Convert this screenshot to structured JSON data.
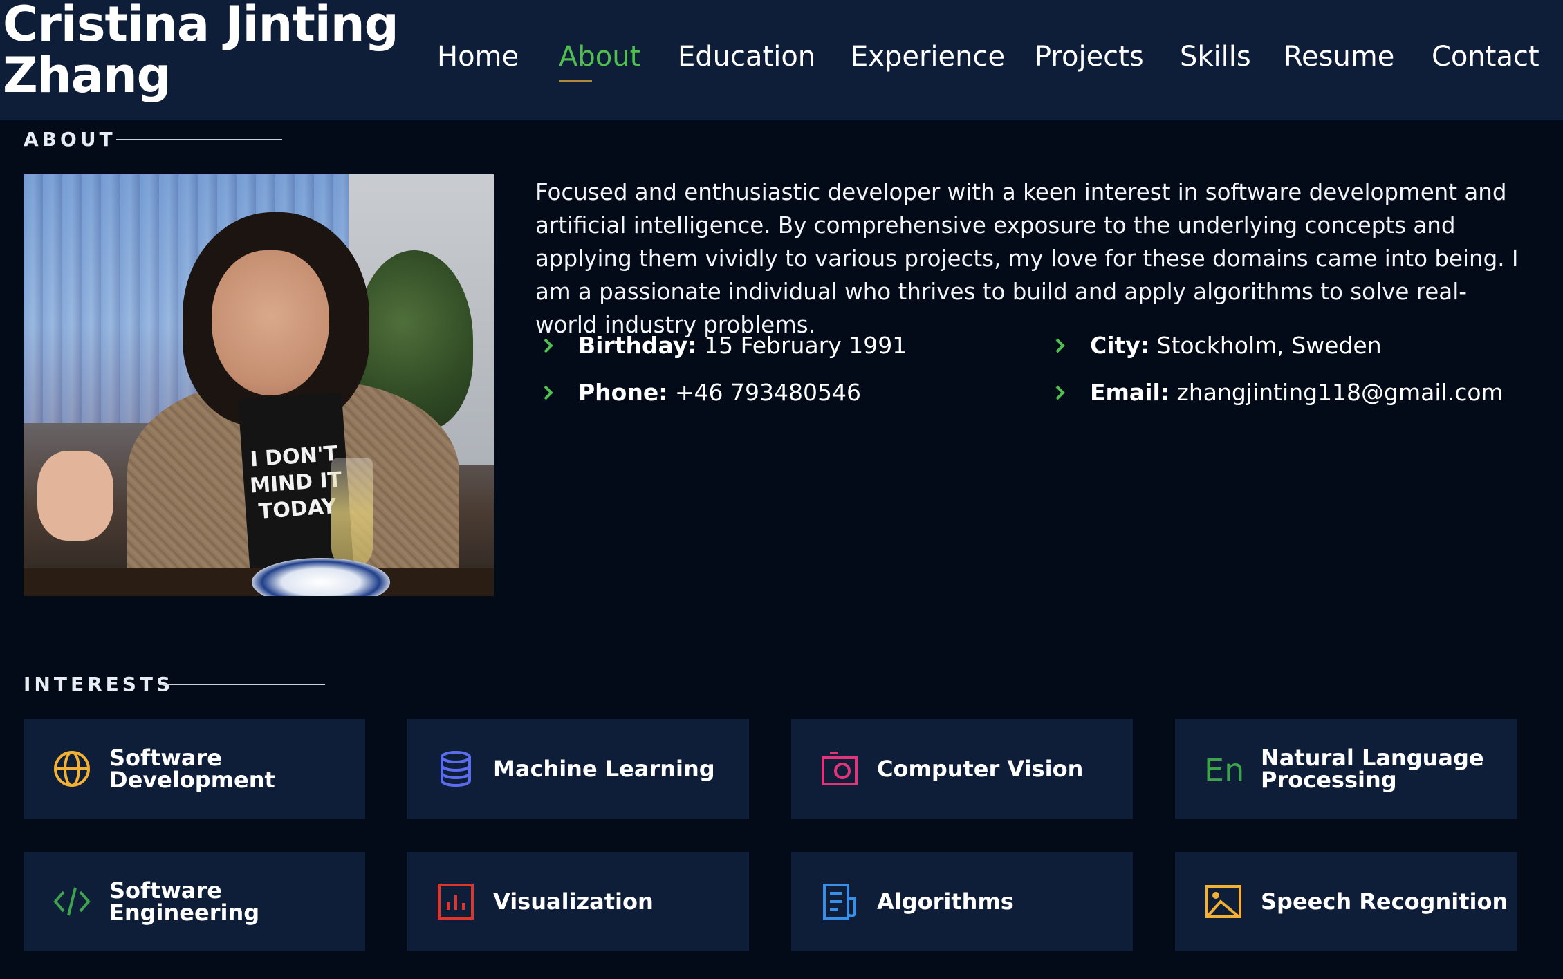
{
  "header": {
    "brand_line1": "Cristina Jinting",
    "brand_line2": "Zhang",
    "nav": [
      {
        "label": "Home"
      },
      {
        "label": "About"
      },
      {
        "label": "Education"
      },
      {
        "label": "Experience"
      },
      {
        "label": "Projects"
      },
      {
        "label": "Skills"
      },
      {
        "label": "Resume"
      },
      {
        "label": "Contact"
      }
    ],
    "active_nav": "About"
  },
  "about": {
    "section_title": "ABOUT",
    "photo_shirt_text": "I DON'T MIND IT TODAY",
    "paragraph": "Focused and enthusiastic developer with a keen interest in software development and artificial intelligence. By comprehensive exposure to the underlying concepts and applying them vividly to various projects, my love for these domains came into being. I am a passionate individual who thrives to build and apply algorithms to solve real-world industry problems.",
    "info": [
      {
        "label": "Birthday:",
        "value": " 15 February 1991"
      },
      {
        "label": "City:",
        "value": " Stockholm, Sweden"
      },
      {
        "label": "Phone:",
        "value": " +46 793480546"
      },
      {
        "label": "Email:",
        "value": " zhangjinting118@gmail.com"
      }
    ]
  },
  "interests": {
    "section_title": "INTERESTS",
    "items": [
      {
        "label": "Software Development",
        "icon": "globe-icon",
        "color": "#f2b134"
      },
      {
        "label": "Machine Learning",
        "icon": "database-icon",
        "color": "#5b6cf0"
      },
      {
        "label": "Computer Vision",
        "icon": "camera-icon",
        "color": "#e0357a"
      },
      {
        "label": "Natural Language Processing",
        "icon": "language-en-icon",
        "color": "#3fa34d"
      },
      {
        "label": "Software Engineering",
        "icon": "code-icon",
        "color": "#3fa34d"
      },
      {
        "label": "Visualization",
        "icon": "bar-chart-icon",
        "color": "#e0352b"
      },
      {
        "label": "Algorithms",
        "icon": "document-icon",
        "color": "#3a8ee6"
      },
      {
        "label": "Speech Recognition",
        "icon": "image-icon",
        "color": "#f2b134"
      }
    ]
  },
  "colors": {
    "accent_green": "#4fbf4f",
    "header_bg": "#0f1e38",
    "page_bg": "#040b18",
    "nav_underline": "#b08a3a"
  }
}
